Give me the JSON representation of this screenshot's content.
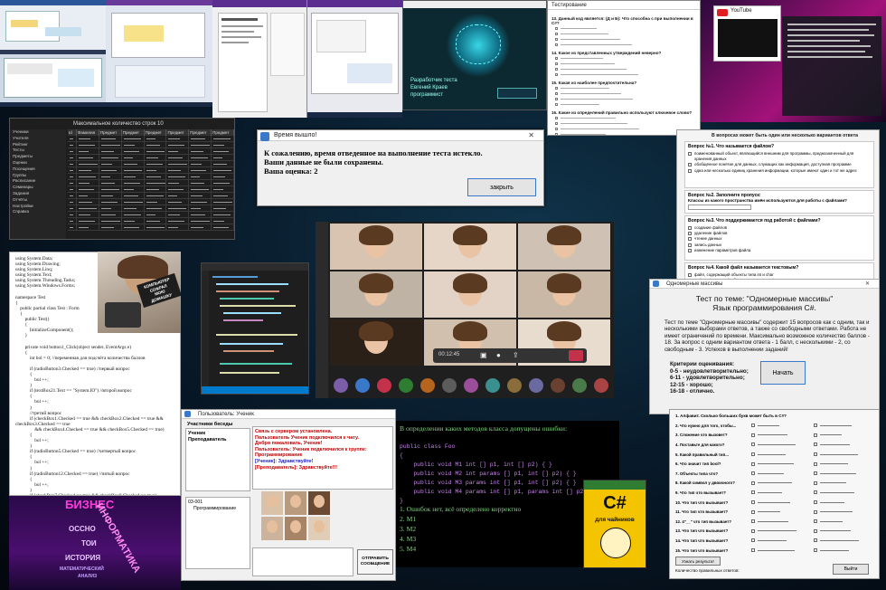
{
  "timeout_dialog": {
    "title": "Время вышло!",
    "line1": "К сожалению, время отведенное на выполнение теста истекло.",
    "line2": "Ваши данные не были сохранены.",
    "grade": "Ваша оценка: 2",
    "close_button": "закрыть"
  },
  "brain_app": {
    "caption": "Разработчик теста\nЕвгений Краев\nпрограммист"
  },
  "arrays_test": {
    "title": "Одномерные массивы",
    "heading1": "Тест по теме: \"Одномерные массивы\"",
    "heading2": "Язык программирования C#.",
    "intro": "Тест по теме \"Одномерные массивы\" содержит 15 вопросов как с одним, так и несколькими выборами ответов, а также со свободными ответами. Работа не имеет ограничений по времени. Максимально возможное количество баллов - 18. За вопрос с одним вариантом ответа - 1 балл, с несколькими - 2, со свободным - 3. Успехов в выполнении заданий!",
    "criteria_title": "Критерии оценивания:",
    "criteria": [
      "0-5 - неудовлетворительно;",
      "6-11 - удовлетворительно;",
      "12-15 - хорошо;",
      "16-18 - отлично."
    ],
    "start_button": "Начать"
  },
  "chat_app": {
    "title": "Пользователь: Ученик",
    "members_label": "Участники беседы",
    "members": [
      "Ученик",
      "Преподаватель"
    ],
    "groups_label": "03-001",
    "group_item": "Программирование",
    "log": [
      {
        "text": "Связь с сервером установлена.",
        "color": "#c00000"
      },
      {
        "text": "Пользователь Ученик подключился к чату.",
        "color": "#c00000"
      },
      {
        "text": "Добро пожаловать, Ученик!",
        "color": "#c00000"
      },
      {
        "text": "Пользователь: Ученик подключился к группе:",
        "color": "#c00000"
      },
      {
        "text": "Программирование",
        "color": "#c00000"
      },
      {
        "text": "[Ученик]: Здравствуйте!",
        "color": "#2222cc"
      },
      {
        "text": "[Преподаватель]: Здравствуйте!!!",
        "color": "#c00000"
      }
    ],
    "send_button": "ОТПРАВИТЬ СООБЩЕНИЕ"
  },
  "methods_question": {
    "question": "В определении каких методов класса допущены ошибки:",
    "code": [
      "public class Foo",
      "{",
      "    public void M1 int [] p1, int [] p2) { }",
      "    public void M2 int params [] p1, int [] p2) { }",
      "    public void M3 params int [] p1, int [] p2) { }",
      "    public void M4 params int [] p1, params int [] p2) { }",
      "}"
    ],
    "answers": [
      "1. Ошибок нет, всё определено корректно",
      "2. М1",
      "3. М2",
      "4. М3",
      "5. М4"
    ]
  },
  "book": {
    "title": "C#",
    "subtitle": "для чайников"
  },
  "poster": {
    "words": [
      "БИЗНЕС",
      "ИНФОРМАТИКА",
      "ОССНО",
      "ТОИ",
      "ИСТОРИЯ",
      "МАТЕМАТИЧЕСКИЙ",
      "АНАЛИЗ"
    ]
  },
  "code_listing": {
    "lines": [
      "using System.Data;",
      "using System.Drawing;",
      "using System.Linq;",
      "using System.Text;",
      "using System.Threading.Tasks;",
      "using System.Windows.Forms;",
      "",
      "namespace Test",
      "{",
      "    public partial class Test : Form",
      "    {",
      "        public Test()",
      "        {",
      "            InitializeComponent();",
      "        }",
      "",
      "        private void button1_Click(object sender, EventArgs e)",
      "        {",
      "            int bol = 0; //переменная для подсчёта количества баллов",
      "",
      "            if (radioButton3.Checked == true) //первый вопрос",
      "            {",
      "                bol ++;",
      "            }",
      "            if (textBox21.Text == \"System.IO\") //второй вопрос",
      "            {",
      "                bol ++;",
      "            }",
      "            //третий вопрос",
      "            if (checkBox1.Checked == true && checkBox2.Checked == true &&",
      "checkBox3.Checked == true",
      "                && checkBox4.Checked == true && checkBox5.Checked == true)",
      "            {",
      "                bol ++;",
      "            }",
      "            if (radioButton5.Checked == true) //четвертый вопрос",
      "            {",
      "                bol ++;",
      "            }",
      "            if (radioButton12.Checked == true) //пятый вопрос",
      "            {",
      "                bol ++;",
      "            }",
      "            if (checkBox7.Checked == true && checkBox8.Checked == true)",
      "//шестой вопрос"
    ]
  },
  "sticker": {
    "text": "КОМПЬЮТЕР\nСОЖРАЛ\nМОЮ\nДОМАШКУ"
  },
  "files_quiz": {
    "header": "В вопросах может быть один или несколько вариантов ответа",
    "q1": "Вопрос №1. Что называется файлом?",
    "q1_options": [
      "поименованный объект, являющийся внешним для программы, предназначенный для хранения данных",
      "обобщённое понятие для данных, служащих как информация, доступная программе",
      "одна или несколько единиц хранения информации, которые имеют один и тот же адрес"
    ],
    "q2": "Вопрос №2. Заполните пропуск:",
    "q2_text": "Классы из какого пространства имён используются для работы с файлами?",
    "q3": "Вопрос №3. Что поддерживается под работой с файлами?",
    "q3_options": [
      "создание файлов",
      "удаление файлов",
      "чтение данных",
      "запись данных",
      "изменение параметров файла"
    ],
    "q4": "Вопрос №4. Какой файл называется текстовым?",
    "q4_options": [
      "файл, содержащий объекты типа int и char",
      "файл, содержащий объекты только типа char",
      "файл, содержащий объекты типа string"
    ]
  },
  "answer_sheet": {
    "title": "1. Алфавит. Сколько больших букв может быть в С#?",
    "questions": [
      "2. Что нужно для того, чтобы...",
      "3. Сложение что вызовет?",
      "4. Поставьте для какого?",
      "5. Какой правильный тип...",
      "6. Что значит тип bool?",
      "7. Объекты типа что?",
      "8. Какой символ у двоичного?",
      "9. Что тип что вызывает?",
      "10. Что тип что вызывает?",
      "11. Что тип что вызывает?",
      "12. 4\"__\" что тип вызывает?",
      "13. Что тип что вызывает?",
      "14. Что тип что вызывает?",
      "15. Что тип что вызывает?"
    ],
    "result_button": "Узнать результат",
    "result_label": "Количество правильных ответов:",
    "exit_button": "Выйти"
  },
  "video_call": {
    "time": "00:12:45"
  },
  "top_right_slides": {
    "youtube_label": "YouTube"
  },
  "quiz_top": {
    "title": "Тестирование",
    "items": [
      "13. Данный код является: (Д и Б): Что способна с при выполнении в С#?",
      "14. Какое из представленных утверждений неверно?",
      "15. Какая из наиболее предпочтительна?",
      "16. Какие из определений правильно используют ключевое слово?",
      "17. Что выведет на экран?"
    ]
  },
  "table_app": {
    "title": "Максимальное количество строк  10",
    "headers": [
      "Id",
      "Фамилия",
      "Предмет",
      "Предмет",
      "Предмет",
      "Предмет",
      "Предмет",
      "Предмет"
    ],
    "sidebar": [
      "Ученики",
      "Учителя",
      "Рейтинг",
      "Тесты",
      "Предметы",
      "Оценки",
      "Посещения",
      "Группы",
      "Расписание",
      "Семинары",
      "Задания",
      "Отчёты",
      "Настройки",
      "Справка"
    ]
  },
  "colors": {
    "accent_blue": "#3a78c9",
    "chat_red": "#c00000",
    "terminal_green": "#7fd17f",
    "terminal_purple": "#c585e6",
    "poster_magenta": "#ff3bd9",
    "book_yellow": "#f5c400"
  }
}
